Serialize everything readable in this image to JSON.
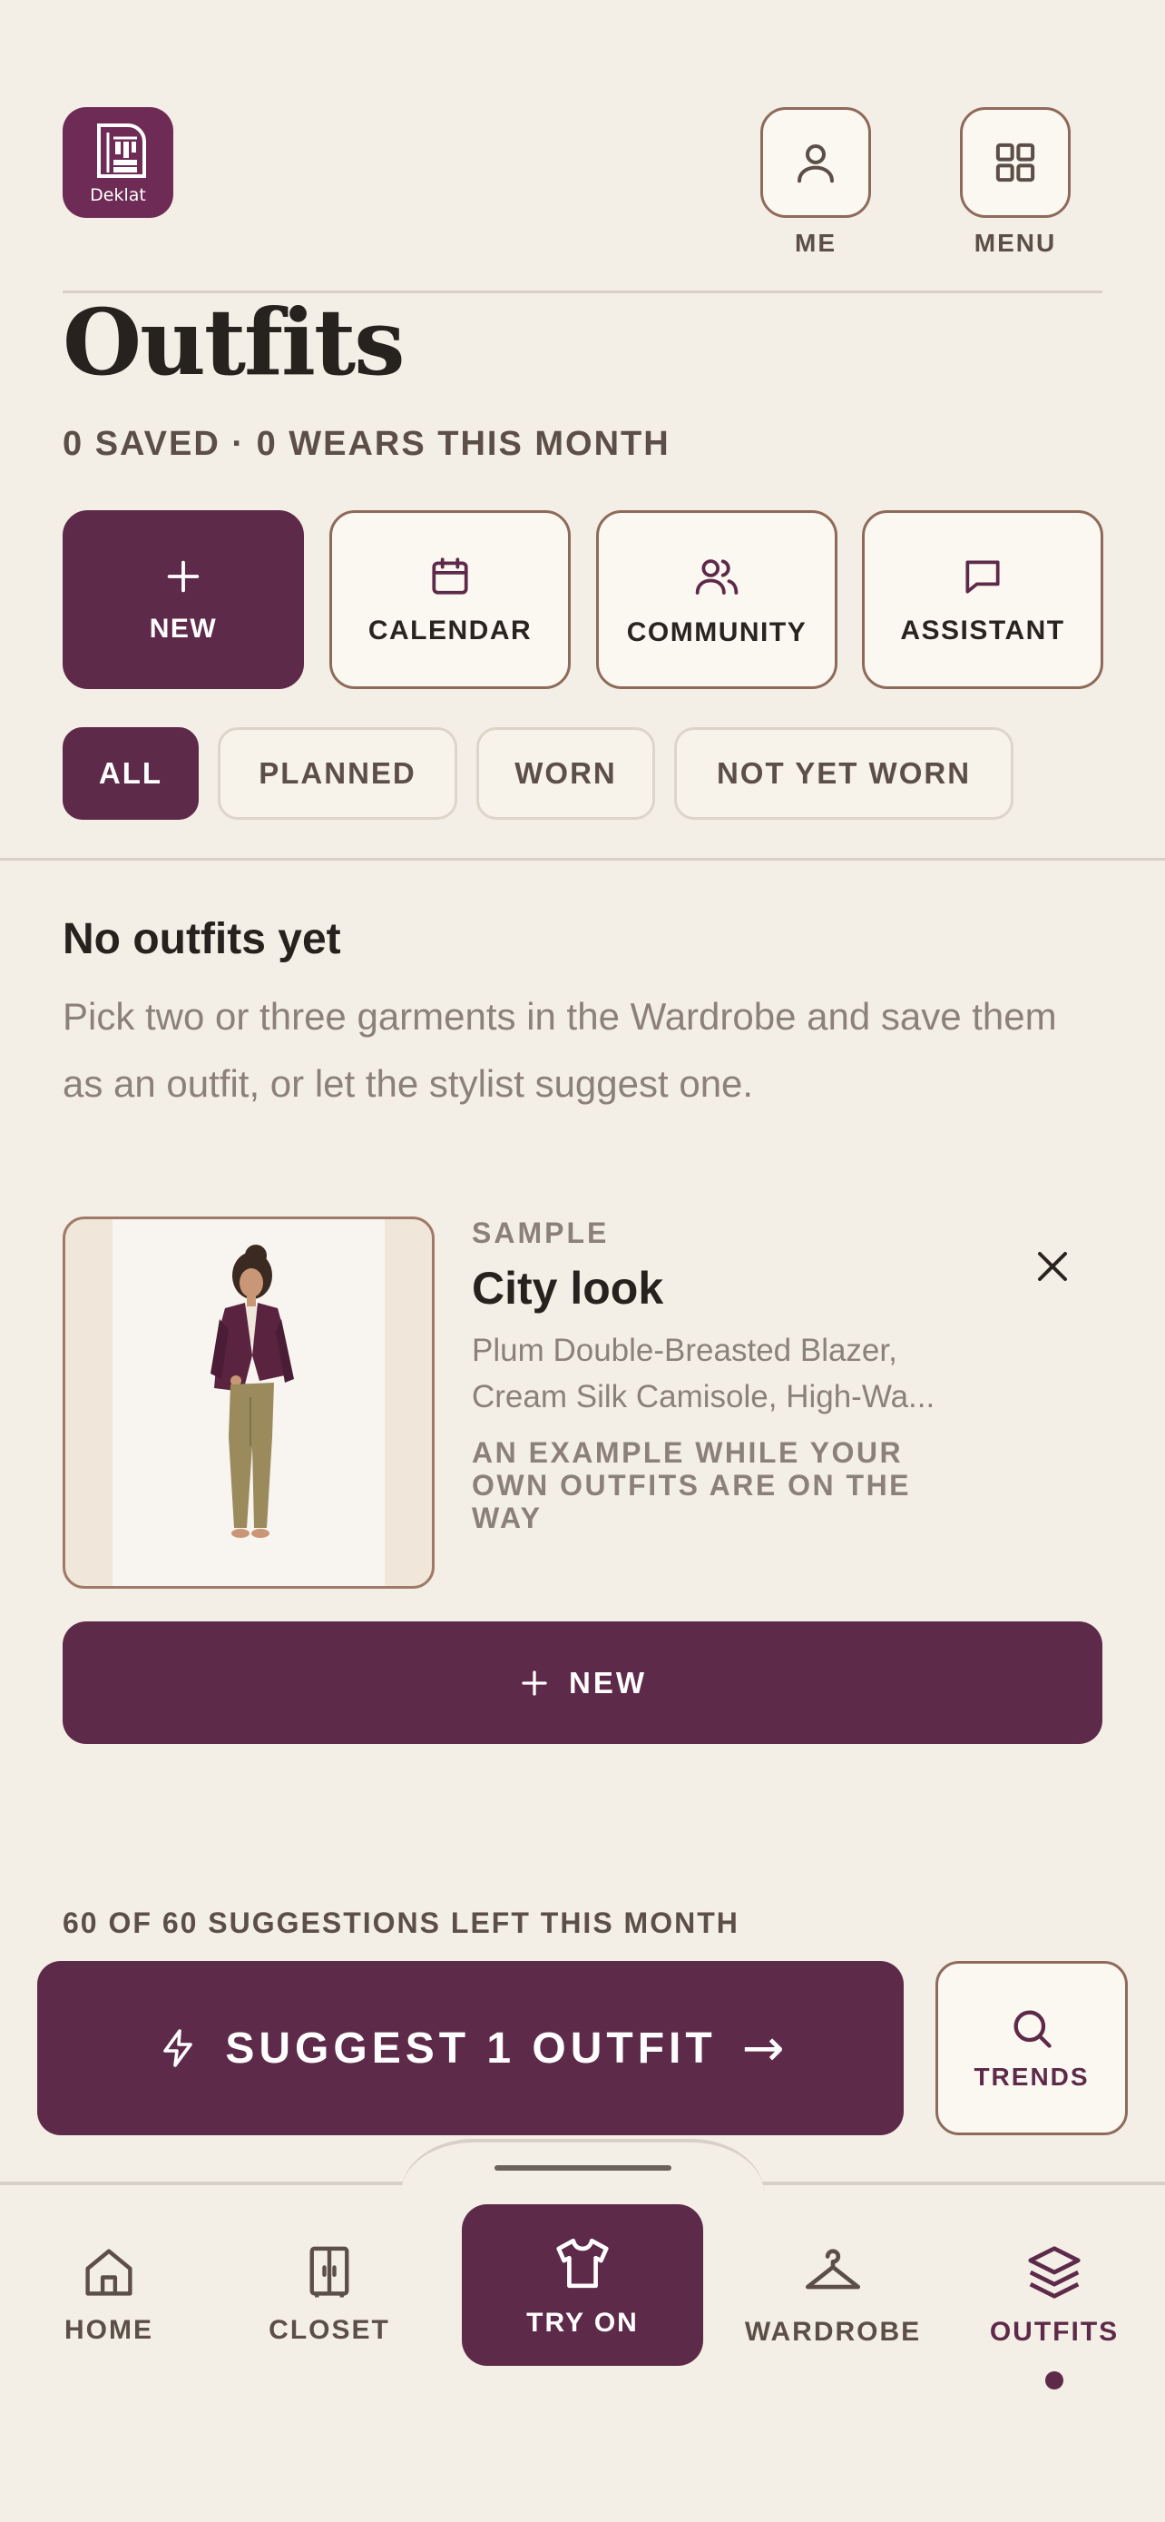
{
  "app": {
    "logo_text": "Deklat"
  },
  "header": {
    "me_label": "ME",
    "menu_label": "MENU"
  },
  "page": {
    "title": "Outfits",
    "subtitle": "0 SAVED · 0 WEARS THIS MONTH"
  },
  "actions": [
    {
      "label": "NEW",
      "icon": "plus-icon"
    },
    {
      "label": "CALENDAR",
      "icon": "calendar-icon"
    },
    {
      "label": "COMMUNITY",
      "icon": "users-icon"
    },
    {
      "label": "ASSISTANT",
      "icon": "chat-icon"
    }
  ],
  "filters": [
    {
      "label": "ALL",
      "active": true
    },
    {
      "label": "PLANNED",
      "active": false
    },
    {
      "label": "WORN",
      "active": false
    },
    {
      "label": "NOT YET WORN",
      "active": false
    }
  ],
  "empty_state": {
    "title": "No outfits yet",
    "body": "Pick two or three garments in the Wardrobe and save them as an outfit, or let the stylist suggest one."
  },
  "sample": {
    "kicker": "SAMPLE",
    "title": "City look",
    "items": "Plum Double-Breasted Blazer, Cream Silk Camisole, High-Wa...",
    "note": "AN EXAMPLE WHILE YOUR OWN OUTFITS ARE ON THE WAY"
  },
  "new_button_label": "NEW",
  "suggestions": {
    "quota": "60 OF 60 SUGGESTIONS LEFT THIS MONTH",
    "button_label": "SUGGEST 1 OUTFIT",
    "arrow": "→",
    "trends_label": "TRENDS"
  },
  "tabbar": [
    {
      "label": "HOME",
      "icon": "home-icon"
    },
    {
      "label": "CLOSET",
      "icon": "closet-icon"
    },
    {
      "label": "TRY ON",
      "icon": "shirt-icon"
    },
    {
      "label": "WARDROBE",
      "icon": "hanger-icon"
    },
    {
      "label": "OUTFITS",
      "icon": "layers-icon",
      "current": true
    }
  ],
  "colors": {
    "accent": "#5e2a49",
    "background": "#f4efe6",
    "border": "#8e6a5a"
  }
}
